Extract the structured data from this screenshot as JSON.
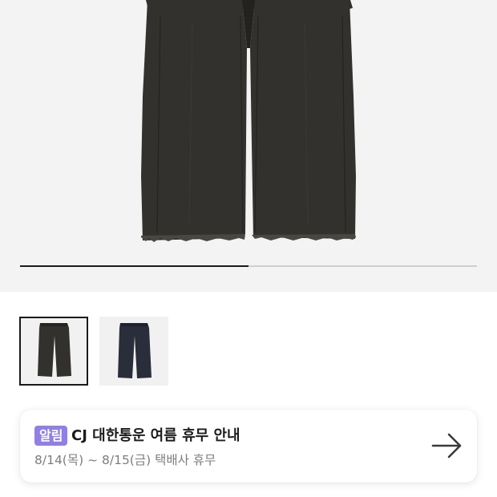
{
  "gallery": {
    "current_image": 1,
    "total_images": 2,
    "progress": 0.5
  },
  "thumbnails": [
    {
      "icon": "black-pants-thumbnail",
      "selected": true
    },
    {
      "icon": "navy-pants-thumbnail",
      "selected": false
    }
  ],
  "notice": {
    "badge": "알림",
    "title": "CJ 대한통운 여름 휴무 안내",
    "subtitle": "8/14(목) ~ 8/15(금) 택배사 휴무",
    "arrow_icon": "arrow-right-icon"
  },
  "colors": {
    "badge_bg": "#8f7fe6",
    "accent_text": "#1c1c1c",
    "muted_text": "#7d7d7d"
  }
}
